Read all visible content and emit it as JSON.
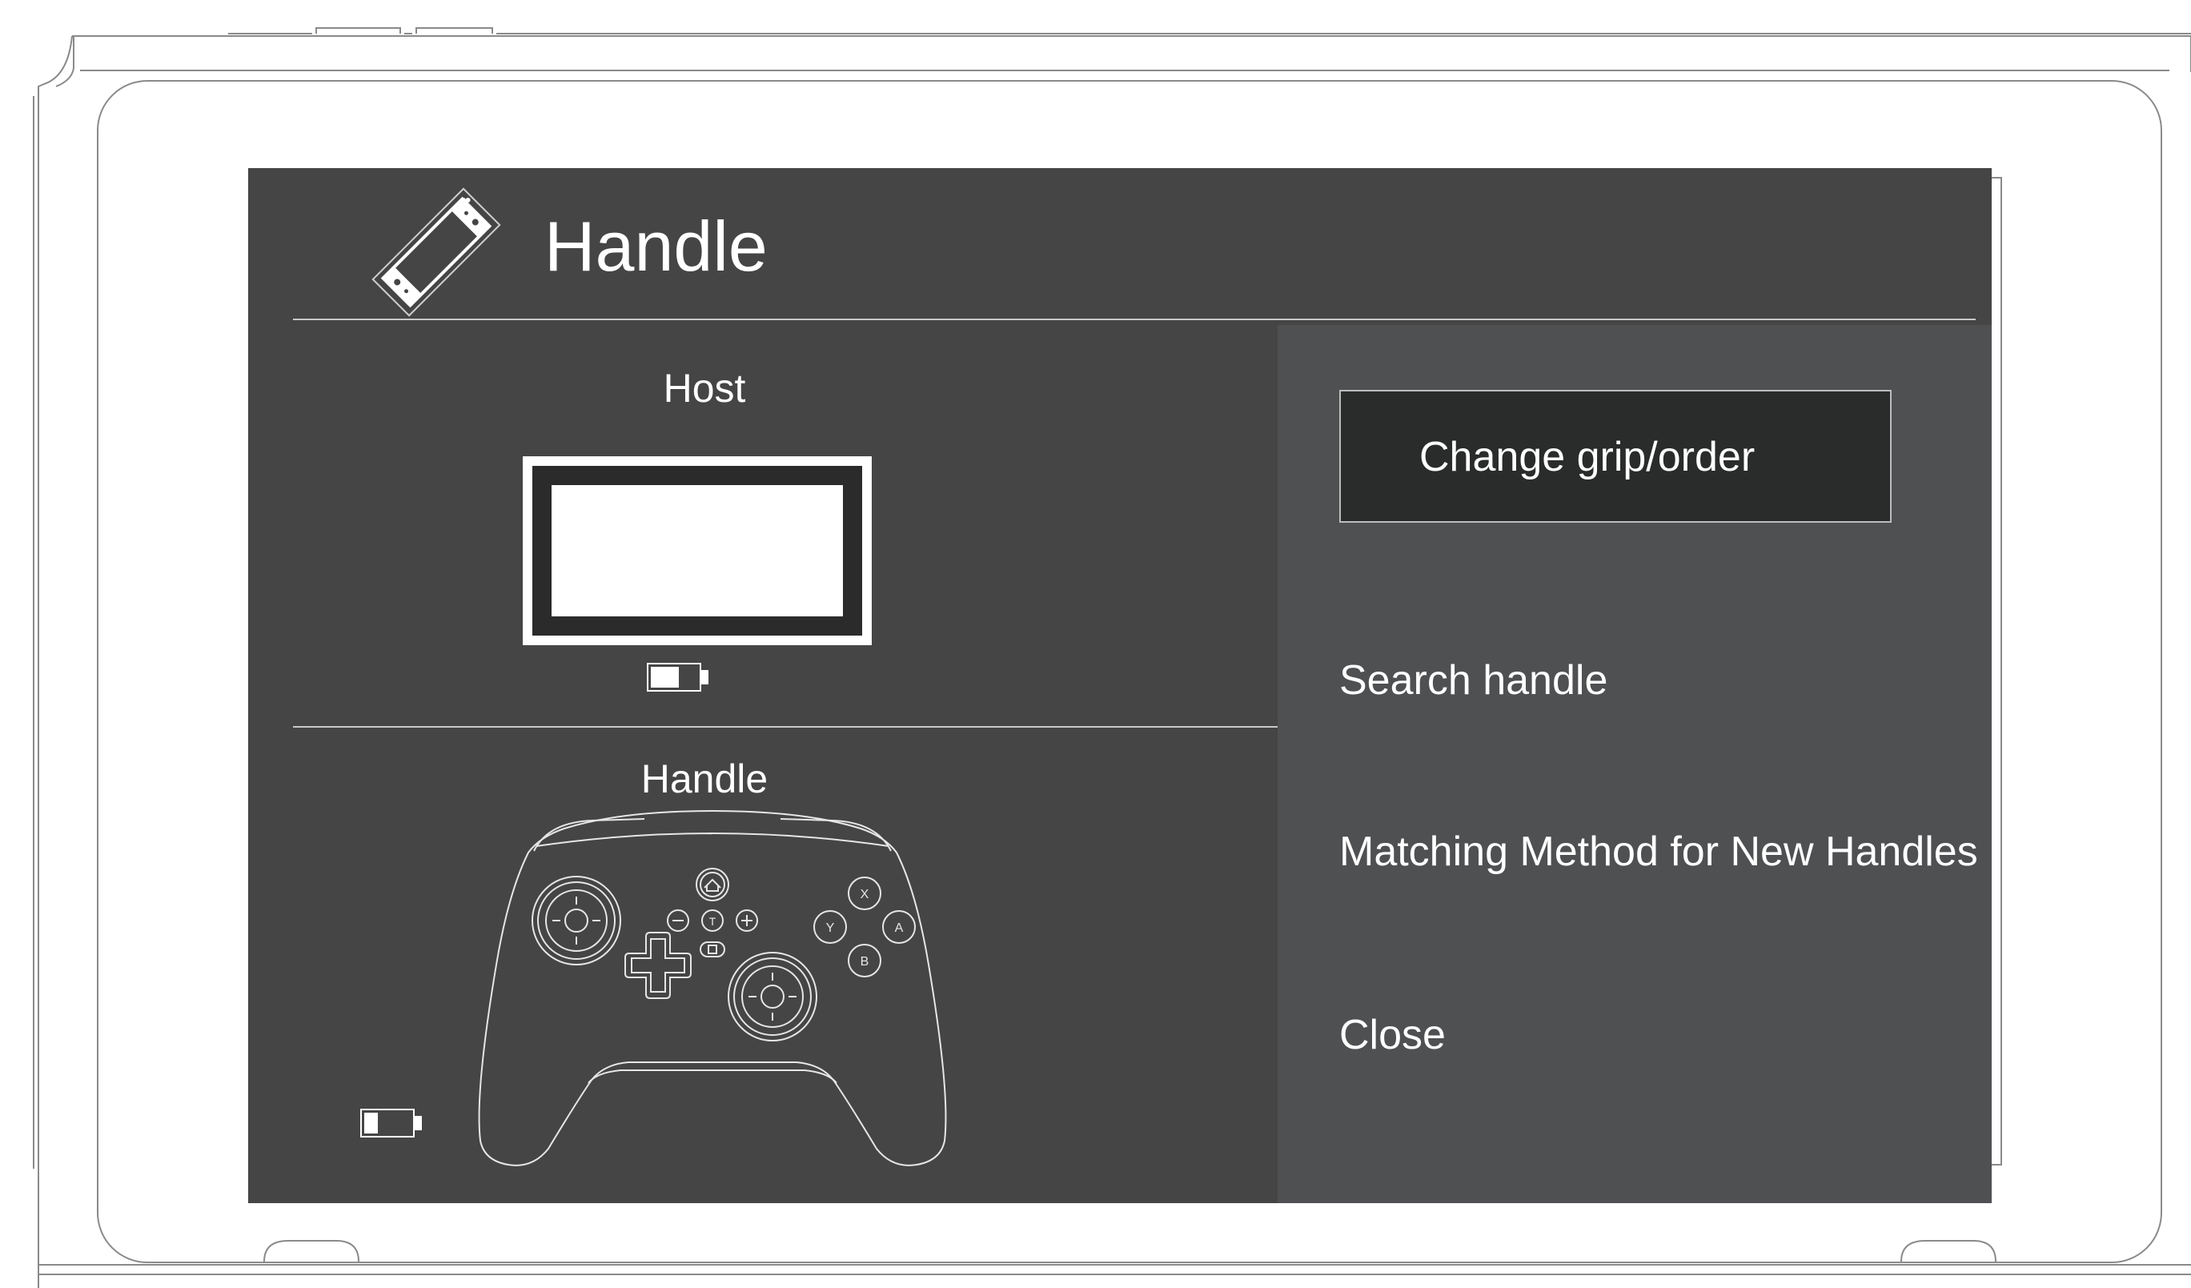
{
  "screen": {
    "title": "Handle",
    "title_icon": "console-icon"
  },
  "left_pane": {
    "host_label": "Host",
    "host_icon": "host-screen-icon",
    "host_battery_icon": "battery-icon",
    "host_battery_level": 0.5,
    "handle_label": "Handle",
    "handle_icon": "gamepad-icon",
    "handle_battery_icon": "battery-icon",
    "handle_battery_level": 0.25,
    "controller_buttons": [
      "X",
      "Y",
      "A",
      "B",
      "T"
    ]
  },
  "menu": {
    "items": [
      {
        "label": "Change grip/order",
        "selected": true
      },
      {
        "label": "Search handle",
        "selected": false
      },
      {
        "label": "Matching Method for New Handles",
        "selected": false
      },
      {
        "label": "Close",
        "selected": false
      }
    ]
  },
  "colors": {
    "panel_bg": "#454545",
    "menu_bg": "#4f5052",
    "selected_bg": "#2a2b2b",
    "text": "#ffffff"
  }
}
